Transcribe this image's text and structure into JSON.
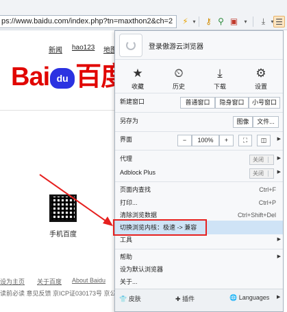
{
  "toolbar": {
    "url": "ps://www.baidu.com/index.php?tn=maxthon2&ch=2",
    "icons": [
      "lightning-icon",
      "dropdown-icon",
      "key-icon",
      "magnifier-icon",
      "screenshot-icon",
      "download-icon",
      "menu-icon"
    ]
  },
  "page": {
    "nav": [
      "新闻",
      "hao123",
      "地图"
    ],
    "logo_left": "Bai",
    "logo_mid": "du",
    "logo_right": "百度",
    "qr_label": "手机百度",
    "footer_row1": [
      "设为主页",
      "关于百度",
      "About Baidu"
    ],
    "footer_row2": "读前必读  意见反馈  京ICP证030173号  京公"
  },
  "menu": {
    "login_text": "登录傲游云浏览器",
    "quick": [
      {
        "icon": "★",
        "label": "收藏"
      },
      {
        "icon": "⏲",
        "label": "历史"
      },
      {
        "icon": "⤓",
        "label": "下载"
      },
      {
        "icon": "⚙",
        "label": "设置"
      }
    ],
    "new_window": "新建窗口",
    "new_window_opts": [
      "普通窗口",
      "隐身窗口",
      "小号窗口"
    ],
    "save_as": "另存为",
    "save_opts": [
      "图像",
      "文件..."
    ],
    "view": "界面",
    "zoom_minus": "−",
    "zoom_value": "100%",
    "zoom_plus": "+",
    "proxy": "代理",
    "proxy_state": "关闭",
    "adblock": "Adblock Plus",
    "adblock_state": "关闭",
    "find": "页面内查找",
    "find_sc": "Ctrl+F",
    "print": "打印...",
    "print_sc": "Ctrl+P",
    "clear": "清除浏览数据",
    "clear_sc": "Ctrl+Shift+Del",
    "switch_core": "切换浏览内核：极速 -> 兼容",
    "tools": "工具",
    "help": "帮助",
    "set_default": "设为默认浏览器",
    "about": "关于...",
    "skin": "皮肤",
    "plugins": "插件",
    "languages": "Languages"
  },
  "colors": {
    "highlight": "#cfe3f6",
    "annotation": "#e6201f",
    "baidu_red": "#e10602",
    "baidu_blue": "#2b32e1"
  }
}
